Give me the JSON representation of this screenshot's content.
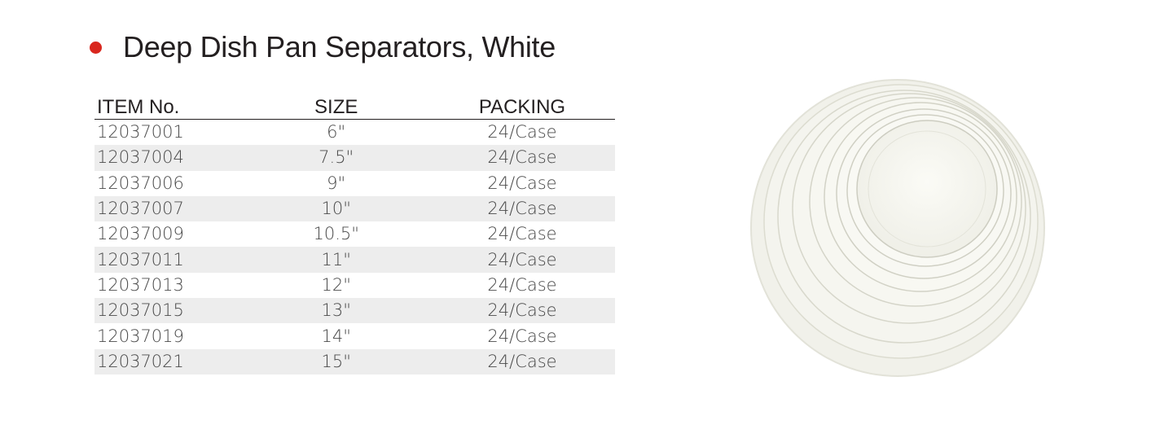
{
  "title": "Deep Dish Pan Separators, White",
  "accent_color": "#d9271e",
  "table": {
    "headers": [
      "ITEM No.",
      "SIZE",
      "PACKING"
    ],
    "rows": [
      [
        "12037001",
        "6\"",
        "24/Case"
      ],
      [
        "12037004",
        "7.5\"",
        "24/Case"
      ],
      [
        "12037006",
        "9\"",
        "24/Case"
      ],
      [
        "12037007",
        "10\"",
        "24/Case"
      ],
      [
        "12037009",
        "10.5\"",
        "24/Case"
      ],
      [
        "12037011",
        "11\"",
        "24/Case"
      ],
      [
        "12037013",
        "12\"",
        "24/Case"
      ],
      [
        "12037015",
        "13\"",
        "24/Case"
      ],
      [
        "12037019",
        "14\"",
        "24/Case"
      ],
      [
        "12037021",
        "15\"",
        "24/Case"
      ]
    ]
  }
}
